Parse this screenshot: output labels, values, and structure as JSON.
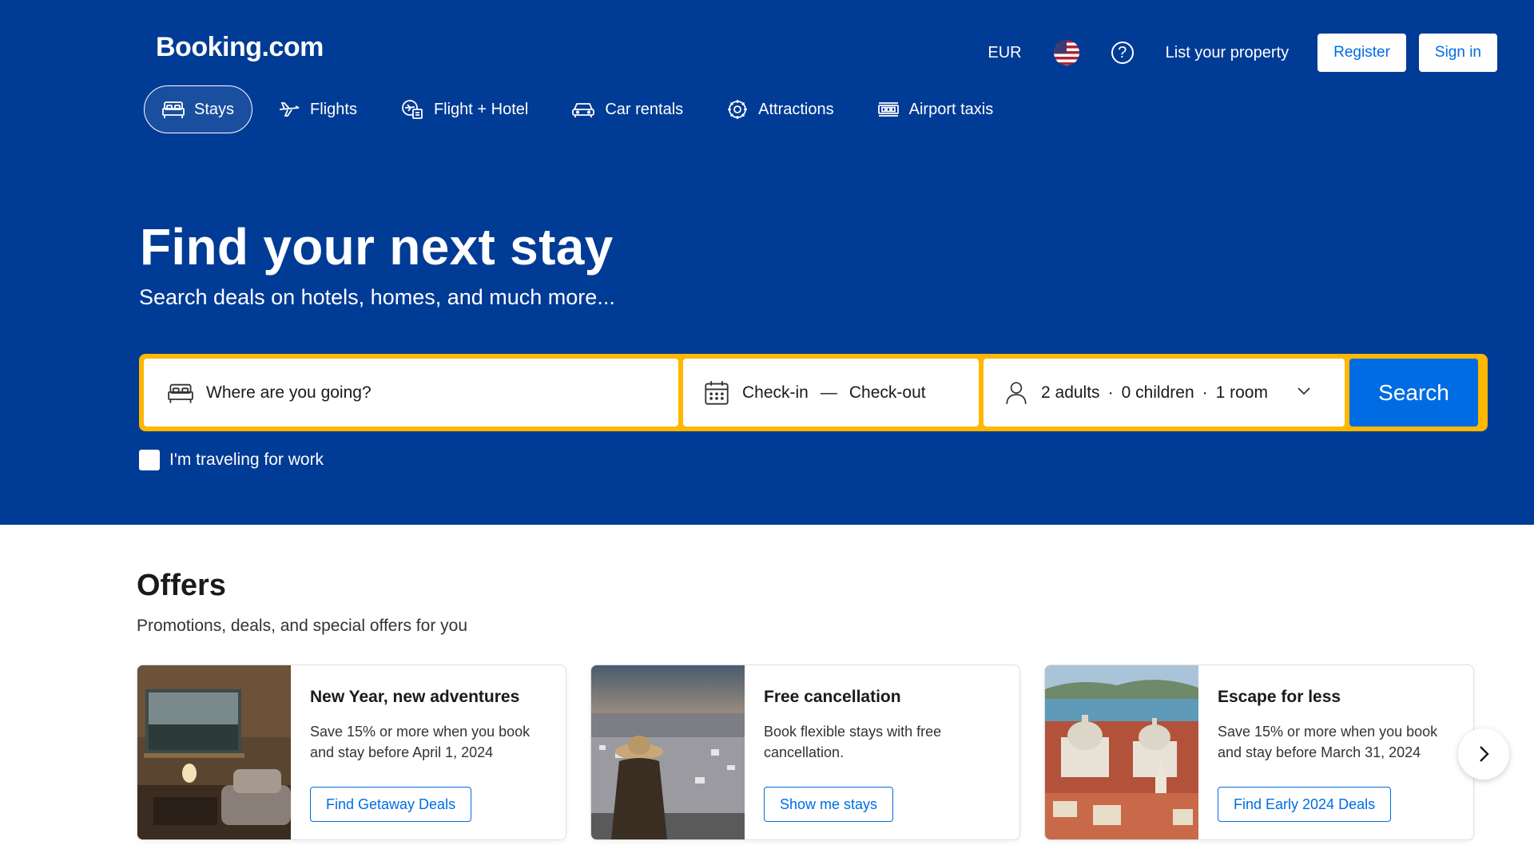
{
  "header": {
    "logo": "Booking.com",
    "currency": "EUR",
    "help_icon": "question-circle-icon",
    "list_property": "List your property",
    "register": "Register",
    "sign_in": "Sign in"
  },
  "nav": {
    "items": [
      {
        "label": "Stays",
        "icon": "bed-icon",
        "active": true
      },
      {
        "label": "Flights",
        "icon": "plane-icon"
      },
      {
        "label": "Flight + Hotel",
        "icon": "flight-hotel-icon"
      },
      {
        "label": "Car rentals",
        "icon": "car-icon"
      },
      {
        "label": "Attractions",
        "icon": "attractions-icon"
      },
      {
        "label": "Airport taxis",
        "icon": "taxi-icon"
      }
    ]
  },
  "hero": {
    "title": "Find your next stay",
    "subtitle": "Search deals on hotels, homes, and much more..."
  },
  "search": {
    "destination_placeholder": "Where are you going?",
    "checkin": "Check-in",
    "dash": "—",
    "checkout": "Check-out",
    "adults": "2 adults",
    "children": "0 children",
    "rooms": "1 room",
    "sep": "·",
    "button": "Search"
  },
  "work_travel": {
    "label": "I'm traveling for work",
    "checked": false
  },
  "offers": {
    "title": "Offers",
    "subtitle": "Promotions, deals, and special offers for you",
    "cards": [
      {
        "title": "New Year, new adventures",
        "desc": "Save 15% or more when you book and stay before April 1, 2024",
        "button": "Find Getaway Deals"
      },
      {
        "title": "Free cancellation",
        "desc": "Book flexible stays with free cancellation.",
        "button": "Show me stays"
      },
      {
        "title": "Escape for less",
        "desc": "Save 15% or more when you book and stay before March 31, 2024",
        "button": "Find Early 2024 Deals"
      }
    ]
  },
  "colors": {
    "brand_blue": "#003b95",
    "accent_blue": "#006ce4",
    "search_border": "#ffb700"
  }
}
